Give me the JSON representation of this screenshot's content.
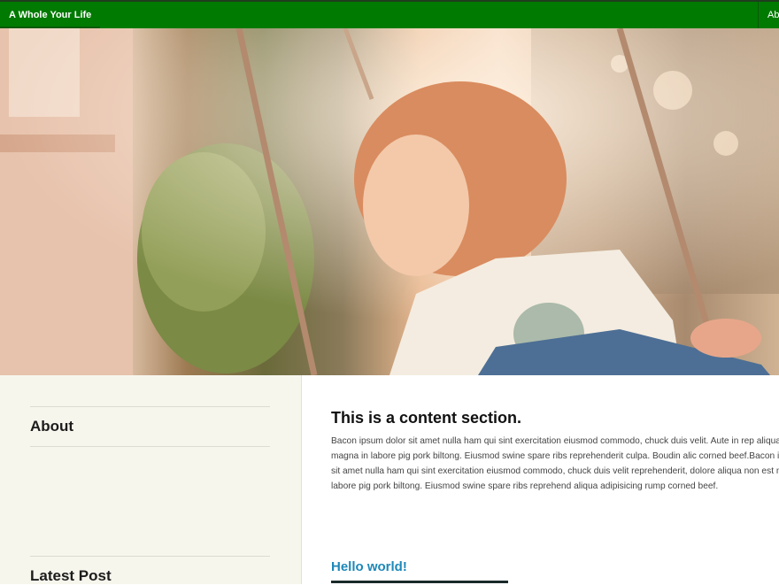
{
  "nav": {
    "brand": "A Whole Your Life",
    "item_about": "Ab"
  },
  "hero": {
    "alt": "Child on a swing"
  },
  "sidebar": {
    "about_title": "About",
    "latest_title": "Latest Post"
  },
  "main": {
    "title": "This is a content section.",
    "body": "Bacon ipsum dolor sit amet nulla ham qui sint exercitation eiusmod commodo, chuck duis velit. Aute in rep aliqua non est magna in labore pig pork biltong. Eiusmod swine spare ribs reprehenderit culpa. Boudin alic corned beef.Bacon ipsum dolor sit amet nulla ham qui sint exercitation eiusmod commodo, chuck duis velit reprehenderit, dolore aliqua non est magna in labore pig pork biltong. Eiusmod swine spare ribs reprehend aliqua adipisicing rump corned beef.",
    "post_link": "Hello world!"
  },
  "colors": {
    "nav_bg": "#007a00",
    "link": "#1e88b8",
    "sidebar_bg": "#f7f6ed"
  }
}
